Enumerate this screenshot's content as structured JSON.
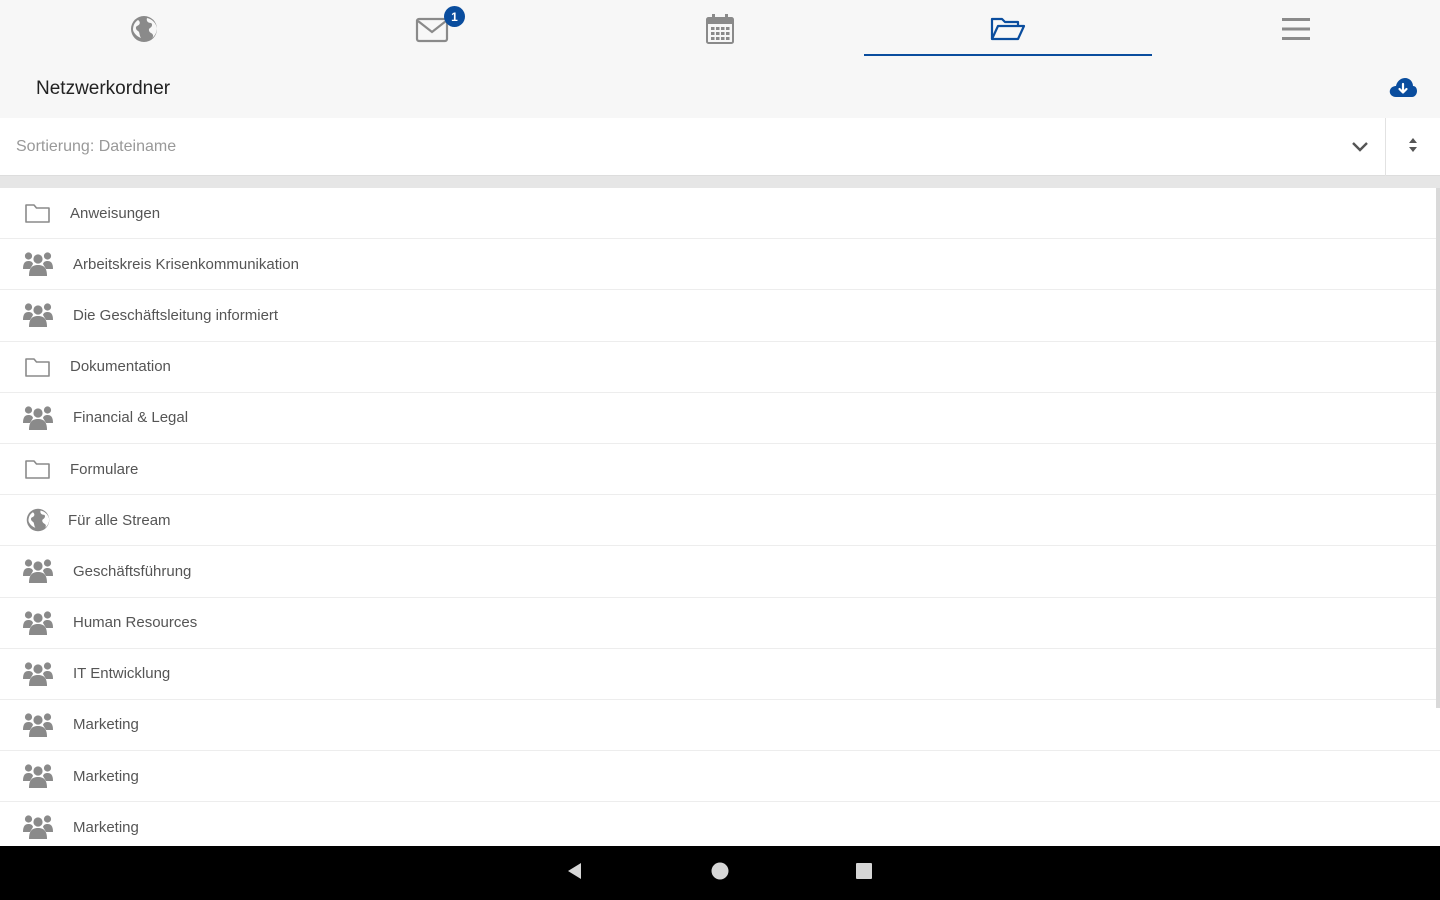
{
  "nav": {
    "tabs": [
      {
        "icon": "globe-icon",
        "active": false
      },
      {
        "icon": "mail-icon",
        "active": false,
        "badge": "1"
      },
      {
        "icon": "calendar-icon",
        "active": false
      },
      {
        "icon": "folder-open-icon",
        "active": true
      },
      {
        "icon": "menu-icon",
        "active": false
      }
    ]
  },
  "header": {
    "title": "Netzwerkordner",
    "action_icon": "cloud-download-icon"
  },
  "sort": {
    "label": "Sortierung: Dateiname",
    "dropdown_icon": "chevron-down-icon",
    "order_icon": "sort-icon"
  },
  "items": [
    {
      "type": "folder",
      "icon": "folder-icon",
      "label": "Anweisungen"
    },
    {
      "type": "group",
      "icon": "group-icon",
      "label": "Arbeitskreis Krisenkommunikation"
    },
    {
      "type": "group",
      "icon": "group-icon",
      "label": "Die Geschäftsleitung informiert"
    },
    {
      "type": "folder",
      "icon": "folder-icon",
      "label": "Dokumentation"
    },
    {
      "type": "group",
      "icon": "group-icon",
      "label": "Financial & Legal"
    },
    {
      "type": "folder",
      "icon": "folder-icon",
      "label": "Formulare"
    },
    {
      "type": "globe",
      "icon": "globe-icon",
      "label": "Für alle Stream"
    },
    {
      "type": "group",
      "icon": "group-icon",
      "label": "Geschäftsführung"
    },
    {
      "type": "group",
      "icon": "group-icon",
      "label": "Human Resources"
    },
    {
      "type": "group",
      "icon": "group-icon",
      "label": "IT Entwicklung"
    },
    {
      "type": "group",
      "icon": "group-icon",
      "label": "Marketing"
    },
    {
      "type": "group",
      "icon": "group-icon",
      "label": "Marketing"
    },
    {
      "type": "group",
      "icon": "group-icon",
      "label": "Marketing"
    }
  ],
  "colors": {
    "accent": "#0a4d9e",
    "icon_gray": "#8a8a8a",
    "background": "#f7f7f7"
  },
  "system_bar": [
    "back-icon",
    "home-icon",
    "recents-icon"
  ]
}
